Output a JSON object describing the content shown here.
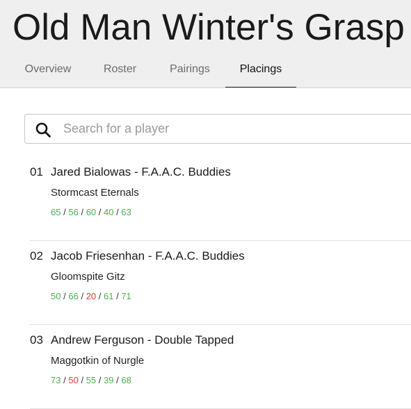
{
  "event": {
    "title": "Old Man Winter's Grasp"
  },
  "tabs": [
    {
      "label": "Overview",
      "active": false
    },
    {
      "label": "Roster",
      "active": false
    },
    {
      "label": "Pairings",
      "active": false
    },
    {
      "label": "Placings",
      "active": true
    }
  ],
  "search": {
    "placeholder": "Search for a player",
    "value": ""
  },
  "placings": [
    {
      "rank": "01",
      "name": "Jared Bialowas - F.A.A.C. Buddies",
      "army": "Stormcast Eternals",
      "scores": [
        {
          "value": "65",
          "result": "win"
        },
        {
          "value": "56",
          "result": "win"
        },
        {
          "value": "60",
          "result": "win"
        },
        {
          "value": "40",
          "result": "win"
        },
        {
          "value": "63",
          "result": "win"
        }
      ]
    },
    {
      "rank": "02",
      "name": "Jacob Friesenhan - F.A.A.C. Buddies",
      "army": "Gloomspite Gitz",
      "scores": [
        {
          "value": "50",
          "result": "win"
        },
        {
          "value": "66",
          "result": "win"
        },
        {
          "value": "20",
          "result": "loss"
        },
        {
          "value": "61",
          "result": "win"
        },
        {
          "value": "71",
          "result": "win"
        }
      ]
    },
    {
      "rank": "03",
      "name": "Andrew Ferguson - Double Tapped",
      "army": "Maggotkin of Nurgle",
      "scores": [
        {
          "value": "73",
          "result": "win"
        },
        {
          "value": "50",
          "result": "loss"
        },
        {
          "value": "55",
          "result": "win"
        },
        {
          "value": "39",
          "result": "win"
        },
        {
          "value": "68",
          "result": "win"
        }
      ]
    }
  ],
  "separator": "/",
  "colors": {
    "win": "#4caf50",
    "loss": "#e53935",
    "header_bg": "#efefef"
  },
  "icons": {
    "search": "search-icon"
  }
}
